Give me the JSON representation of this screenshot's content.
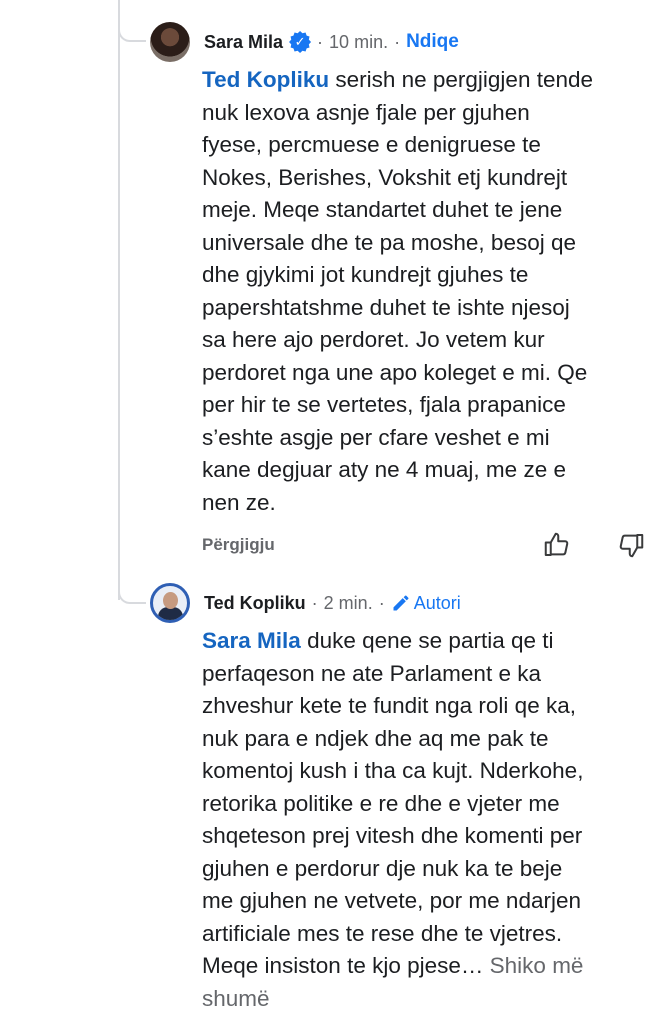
{
  "comments": [
    {
      "author": "Sara Mila",
      "time": "10 min.",
      "follow_label": "Ndiqe",
      "mention": "Ted Kopliku",
      "lines": [
        " serish ne pergjigjen tende",
        "nuk lexova asnje fjale per gjuhen",
        "fyese, percmuese e denigruese te",
        "Nokes, Berishes, Vokshit etj kundrejt",
        "meje. Meqe standartet duhet te jene",
        "universale dhe te pa moshe, besoj qe",
        "dhe gjykimi jot kundrejt gjuhes te",
        "papershtatshme duhet te ishte njesoj",
        "sa here ajo perdoret. Jo vetem kur",
        "perdoret nga une apo koleget e mi. Qe",
        "per hir te se vertetes, fjala prapanice",
        "s’eshte asgje per cfare veshet e mi",
        "kane degjuar aty ne 4 muaj, me ze e",
        "nen ze."
      ],
      "reply_label": "Përgjigju",
      "icons": [
        "verified-badge-icon",
        "like-icon",
        "dislike-icon"
      ]
    },
    {
      "author": "Ted Kopliku",
      "time": "2 min.",
      "author_badge": "Autori",
      "mention": "Sara Mila",
      "lines": [
        " duke qene se partia qe ti",
        "perfaqeson ne ate Parlament e ka",
        "zhveshur kete te fundit nga roli qe ka,",
        "nuk para e ndjek dhe aq me pak te",
        "komentoj kush i tha ca kujt. Nderkohe,",
        "retorika politike e re dhe e vjeter me",
        "shqeteson prej vitesh dhe komenti per",
        "gjuhen e perdorur dje nuk ka te beje",
        "me gjuhen ne vetvete, por me  ndarjen",
        "artificiale mes te rese dhe te vjetres.",
        "Meqe insiston te kjo pjese…"
      ],
      "see_more": " Shiko më",
      "see_more_2": "shumë",
      "icons": [
        "pencil-icon"
      ]
    }
  ],
  "colors": {
    "link": "#1877f2",
    "mention": "#1565c0",
    "muted": "#65676b",
    "thread": "#d8dade"
  }
}
